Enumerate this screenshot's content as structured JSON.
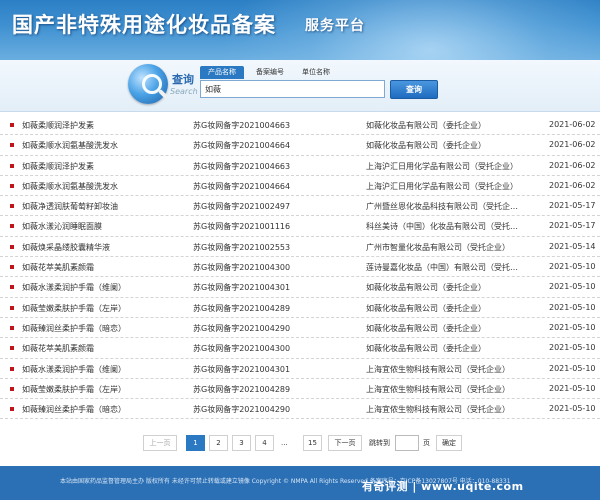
{
  "header": {
    "title": "国产非特殊用途化妆品备案",
    "subtitle": "服务平台"
  },
  "search": {
    "label": "查询",
    "label_en": "Search",
    "tabs": [
      "产品名称",
      "备案编号",
      "单位名称"
    ],
    "active_tab": 0,
    "value": "如薇",
    "button_label": "查询"
  },
  "records": [
    {
      "name": "如薇柔顺润泽护发素",
      "code": "苏G妆网备字2021004663",
      "company": "如薇化妆品有限公司（委托企业）",
      "date": "2021-06-02"
    },
    {
      "name": "如薇柔顺水润氨基酸洗发水",
      "code": "苏G妆网备字2021004664",
      "company": "如薇化妆品有限公司（委托企业）",
      "date": "2021-06-02"
    },
    {
      "name": "如薇柔顺润泽护发素",
      "code": "苏G妆网备字2021004663",
      "company": "上海沪汇日用化学品有限公司（受托企业）",
      "date": "2021-06-02"
    },
    {
      "name": "如薇柔顺水润氨基酸洗发水",
      "code": "苏G妆网备字2021004664",
      "company": "上海沪汇日用化学品有限公司（受托企业）",
      "date": "2021-06-02"
    },
    {
      "name": "如薇净透润肤葡萄籽卸妆油",
      "code": "苏G妆网备字2021002497",
      "company": "广州暨丝恩化妆品科技有限公司（受托企…",
      "date": "2021-05-17"
    },
    {
      "name": "如薇水漾沁润睡眠面膜",
      "code": "苏G妆网备字2021001116",
      "company": "科丝美诗（中国）化妆品有限公司（受托…",
      "date": "2021-05-17"
    },
    {
      "name": "如薇焕采晶缕胶囊精华液",
      "code": "苏G妆网备字2021002553",
      "company": "广州市智量化妆品有限公司（受托企业）",
      "date": "2021-05-14"
    },
    {
      "name": "如薇花萃美肌素颜霜",
      "code": "苏G妆网备字2021004300",
      "company": "莲诗曼嘉化妆品（中国）有限公司（受托…",
      "date": "2021-05-10"
    },
    {
      "name": "如薇水漾柔润护手霜（维阑）",
      "code": "苏G妆网备字2021004301",
      "company": "如薇化妆品有限公司（委托企业）",
      "date": "2021-05-10"
    },
    {
      "name": "如薇莹嫩柔肤护手霜（左岸）",
      "code": "苏G妆网备字2021004289",
      "company": "如薇化妆品有限公司（委托企业）",
      "date": "2021-05-10"
    },
    {
      "name": "如薇臻润丝柔护手霜（暗恋）",
      "code": "苏G妆网备字2021004290",
      "company": "如薇化妆品有限公司（委托企业）",
      "date": "2021-05-10"
    },
    {
      "name": "如薇花萃美肌素颜霜",
      "code": "苏G妆网备字2021004300",
      "company": "如薇化妆品有限公司（委托企业）",
      "date": "2021-05-10"
    },
    {
      "name": "如薇水漾柔润护手霜（维阑）",
      "code": "苏G妆网备字2021004301",
      "company": "上海宜侬生物科技有限公司（受托企业）",
      "date": "2021-05-10"
    },
    {
      "name": "如薇莹嫩柔肤护手霜（左岸）",
      "code": "苏G妆网备字2021004289",
      "company": "上海宜侬生物科技有限公司（受托企业）",
      "date": "2021-05-10"
    },
    {
      "name": "如薇臻润丝柔护手霜（暗恋）",
      "code": "苏G妆网备字2021004290",
      "company": "上海宜侬生物科技有限公司（受托企业）",
      "date": "2021-05-10"
    }
  ],
  "pagination": {
    "prev": "上一页",
    "pages": [
      "1",
      "2",
      "3",
      "4"
    ],
    "ellipsis": "...",
    "last": "15",
    "next": "下一页",
    "goto_label": "跳转到",
    "page_unit": "页",
    "confirm": "确定",
    "current": "1"
  },
  "footer": {
    "text": "本站由国家药品监督管理局主办 版权所有 未经许可禁止转载或建立镜像 Copyright © NMPA All Rights Reserved 备案序号：京ICP备13027807号 电话：010-88331",
    "watermark": "有奇评测 | www.uqite.com"
  },
  "colors": {
    "header_blue": "#2c7fc4",
    "accent_blue": "#2b79c2",
    "bullet_red": "#c0151b",
    "footer_blue": "#2b6fb5"
  }
}
